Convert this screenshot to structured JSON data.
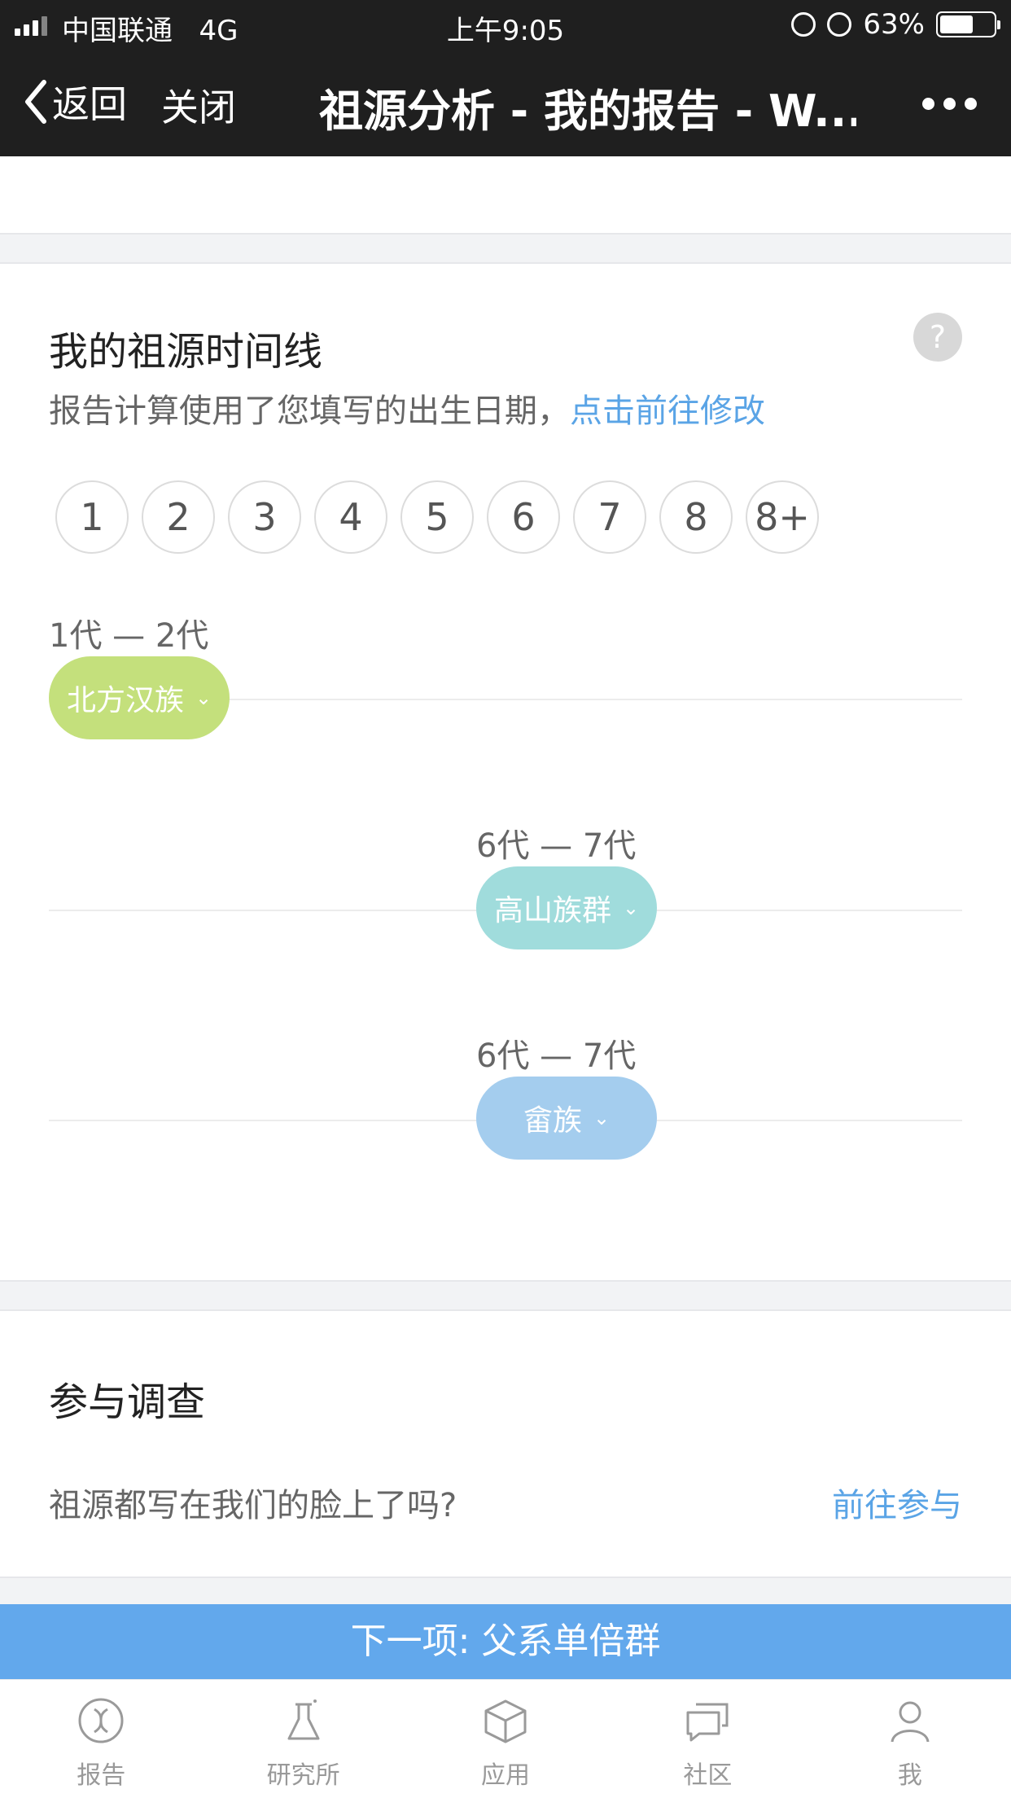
{
  "status_bar": {
    "carrier": "中国联通",
    "network": "4G",
    "time": "上午9:05",
    "battery": "63%",
    "battery_level": 0.63
  },
  "nav": {
    "back": "返回",
    "close": "关闭",
    "title": "祖源分析 - 我的报告 - W..."
  },
  "timeline": {
    "title": "我的祖源时间线",
    "help": "?",
    "subtitle_text": "报告计算使用了您填写的出生日期，",
    "subtitle_link": "点击前往修改",
    "generations": [
      "1",
      "2",
      "3",
      "4",
      "5",
      "6",
      "7",
      "8",
      "8+"
    ],
    "entries": [
      {
        "range": "1代 — 2代",
        "population": "北方汉族",
        "color": "#c4e07c"
      },
      {
        "range": "6代 — 7代",
        "population": "高山族群",
        "color": "#a0dcdc"
      },
      {
        "range": "6代 — 7代",
        "population": "畲族",
        "color": "#a4cdee"
      }
    ]
  },
  "survey": {
    "title": "参与调查",
    "question": "祖源都写在我们的脸上了吗?",
    "action": "前往参与"
  },
  "next": {
    "label": "下一项: 父系单倍群"
  },
  "tabs": [
    {
      "label": "报告",
      "icon": "dna-icon"
    },
    {
      "label": "研究所",
      "icon": "flask-icon"
    },
    {
      "label": "应用",
      "icon": "cube-icon"
    },
    {
      "label": "社区",
      "icon": "chat-icon"
    },
    {
      "label": "我",
      "icon": "person-icon"
    }
  ],
  "colors": {
    "accent": "#5aa4e6",
    "next_bar": "#62a8ec",
    "nav_bg": "#1f1f1f"
  }
}
